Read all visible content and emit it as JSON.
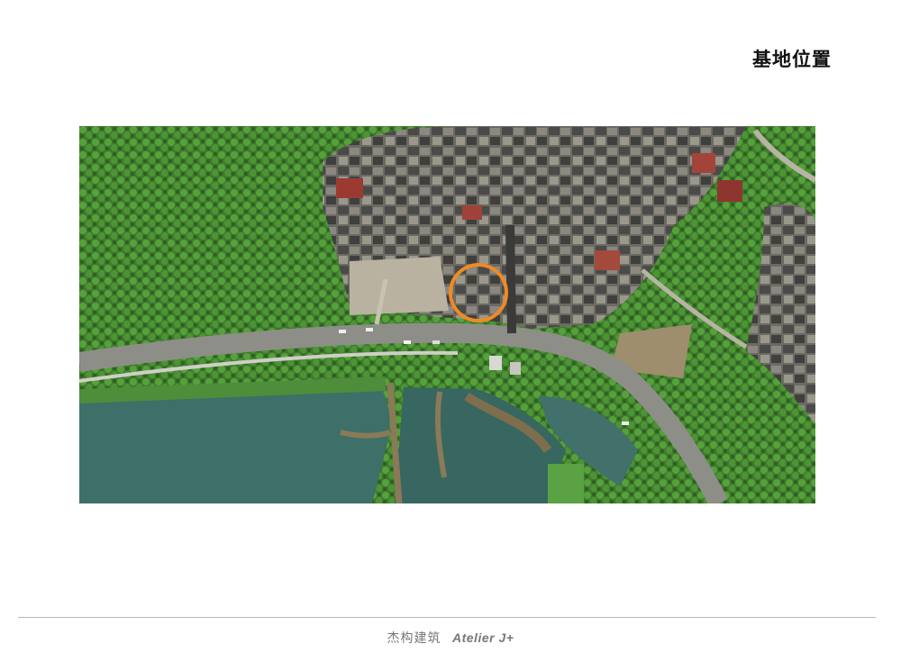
{
  "page": {
    "title": "基地位置"
  },
  "map": {
    "type": "satellite-aerial",
    "marker": {
      "shape": "circle",
      "color": "#f08a24",
      "meaning": "site-location"
    }
  },
  "footer": {
    "studio_cn": "杰构建筑",
    "studio_en": "Atelier J+"
  }
}
